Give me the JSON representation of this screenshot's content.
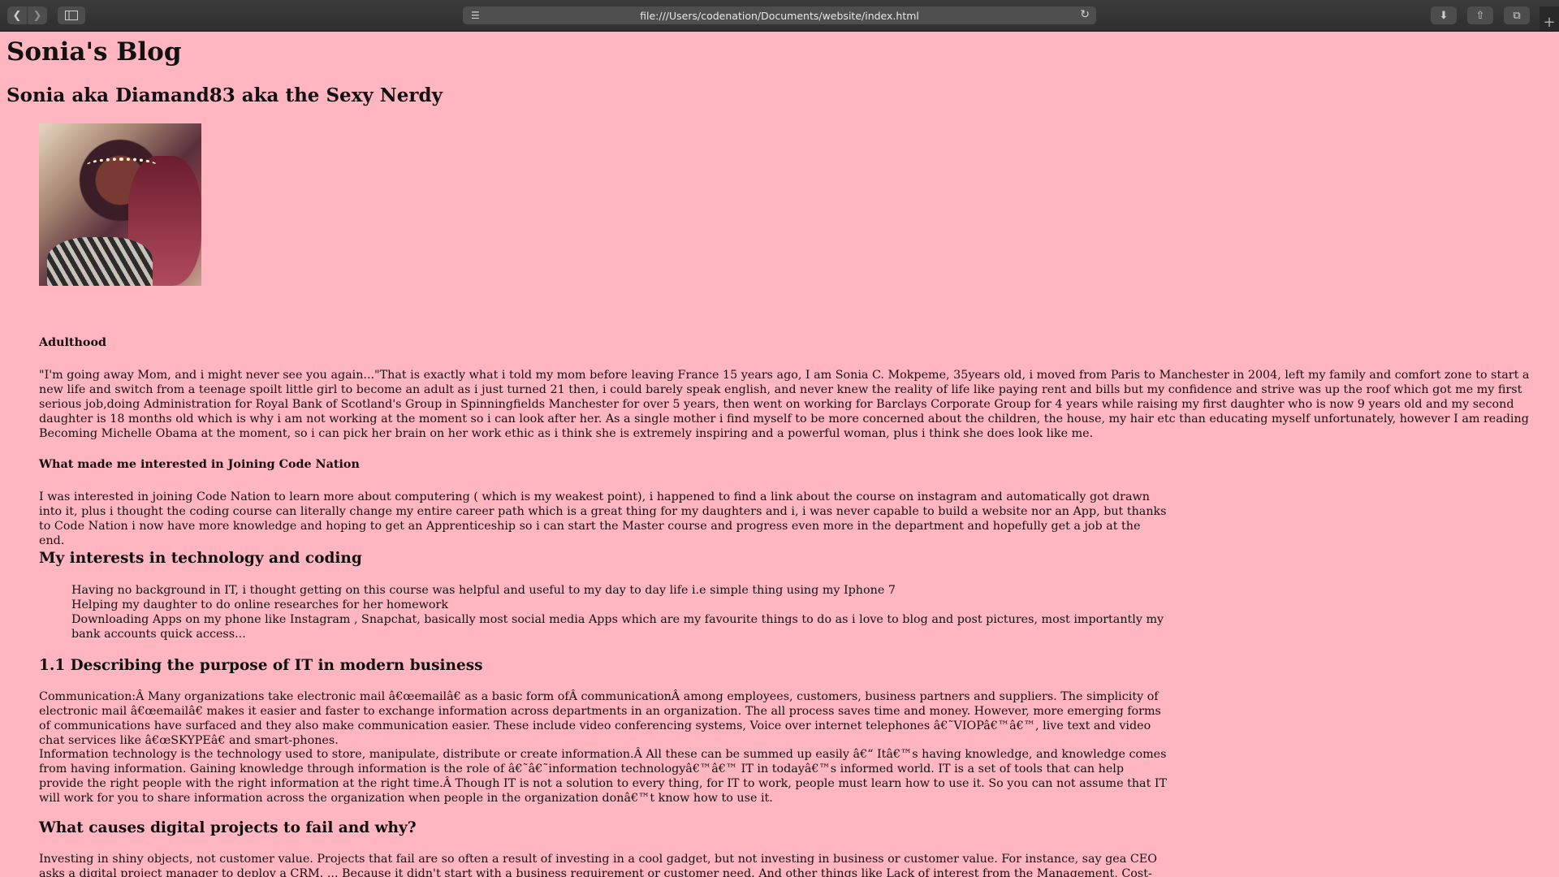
{
  "browser": {
    "url": "file:///Users/codenation/Documents/website/index.html"
  },
  "page": {
    "title": "Sonia's Blog",
    "subtitle": "Sonia aka Diamand83 aka the Sexy Nerdy",
    "sections": {
      "adulthood_heading": "Adulthood",
      "adulthood_text": "\"I'm going away Mom, and i might never see you again...\"That is exactly what i told my mom before leaving France 15 years ago, I am Sonia C. Mokpeme, 35years old, i moved from Paris to Manchester in 2004, left my family and comfort zone to start a new life and switch from a teenage spoilt little girl to become an adult as i just turned 21 then, i could barely speak english, and never knew the reality of life like paying rent and bills but my confidence and strive was up the roof which got me my first serious job,doing Administration for Royal Bank of Scotland's Group in Spinningfields Manchester for over 5 years, then went on working for Barclays Corporate Group for 4 years while raising my first daughter who is now 9 years old and my second daughter is 18 months old which is why i am not working at the moment so i can look after her. As a single mother i find myself to be more concerned about the children, the house, my hair etc than educating myself unfortunately, however I am reading Becoming Michelle Obama at the moment, so i can pick her brain on her work ethic as i think she is extremely inspiring and a powerful woman, plus i think she does look like me.",
      "codenation_heading": "What made me interested in Joining Code Nation",
      "codenation_text": "I was interested in joining Code Nation to learn more about computering ( which is my weakest point), i happened to find a link about the course on instagram and automatically got drawn into it, plus i thought the coding course can literally change my entire career path which is a great thing for my daughters and i, i was never capable to build a website nor an App, but thanks to Code Nation i now have more knowledge and hoping to get an Apprenticeship so i can start the Master course and progress even more in the department and hopefully get a job at the end.",
      "interests_heading": "My interests in technology and coding",
      "interests": [
        "Having no background in IT, i thought getting on this course was helpful and useful to my day to day life i.e simple thing using my Iphone 7",
        "Helping my daughter to do online researches for her homework",
        "Downloading Apps on my phone like Instagram , Snapchat, basically most social media Apps which are my favourite things to do as i love to blog and post pictures, most importantly my bank accounts quick access..."
      ],
      "purpose_heading": "1.1 Describing the purpose of IT in modern business",
      "purpose_text_1": "Communication:Â Many organizations take electronic mail â€œemailâ€ as a basic form ofÂ communicationÂ among employees, customers, business partners and suppliers. The simplicity of electronic mail â€œemailâ€ makes it easier and faster to exchange information across departments in an organization. The all process saves time and money. However, more emerging forms of communications have surfaced and they also make communication easier. These include video conferencing systems, Voice over internet telephones â€˜VIOPâ€™â€™, live text and video chat services like â€œSKYPEâ€ and smart-phones.",
      "purpose_text_2": "Information technology is the technology used to store, manipulate, distribute or create information.Â  All these can be summed up easily â€“ Itâ€™s having knowledge, and knowledge comes from having information. Gaining knowledge through information is the role of â€˜â€˜information technologyâ€™â€™ IT in todayâ€™s informed world. IT is a set of tools that can help provide the right people with the right information at the right time.Â  Though IT is not a solution to every thing, for IT to work, people must learn how to use it. So you can not assume that IT will work for you to share information across the organization when people in the organization donâ€™t know how to use it.",
      "fail_heading": "What causes digital projects to fail and why?",
      "fail_text": "Investing in shiny objects, not customer value. Projects that fail are so often a result of investing in a cool gadget, but not investing in business or customer value. For instance, say gea CEO asks a digital project manager to deploy a CRM. ... Because it didn't start with a business requirement or customer need. And other things like Lack of interest from the Management, Cost-cutting Approaches, Lack of proper planning, failure to manage Scope Creep, Overly-optmistic Project Schedule, Overstaffing of Projects, Poor Communication"
    }
  }
}
